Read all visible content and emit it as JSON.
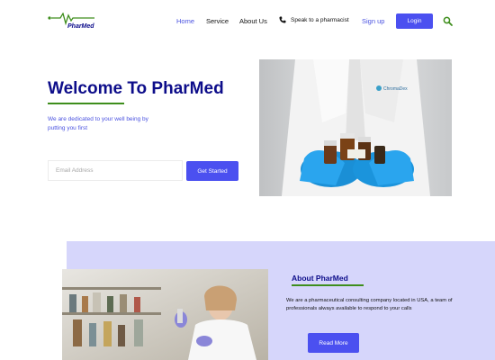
{
  "brand": {
    "name": "PharMed",
    "green": "#3e8e1c",
    "navy": "#0d0d8a",
    "accent": "#4b50f0"
  },
  "nav": {
    "items": [
      {
        "label": "Home",
        "active": true
      },
      {
        "label": "Service",
        "active": false
      },
      {
        "label": "About Us",
        "active": false
      }
    ],
    "phone_label": "Speak to a pharmacist",
    "signup_label": "Sign up",
    "login_label": "Login",
    "search_icon": "search-icon"
  },
  "hero": {
    "title": "Welcome To PharMed",
    "subtitle": "We are dedicated to your well being by putting you first",
    "email_placeholder": "Email Address",
    "cta_label": "Get Started",
    "photo_label": "ChromaDex"
  },
  "about": {
    "title": "About PharMed",
    "text": "We are a pharmaceutical consulting company located in USA, a team of professionals always available to respond to your calls",
    "button_label": "Read More"
  }
}
